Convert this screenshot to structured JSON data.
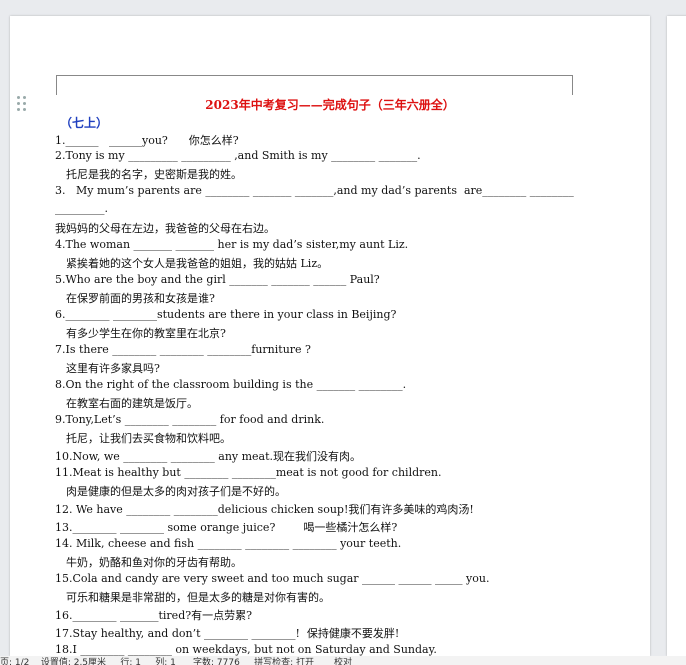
{
  "document": {
    "title": "2023年中考复习——完成句子（三年六册全）",
    "section": "（七上）",
    "lines": [
      "1.______   ______you?      你怎么样?",
      "2.Tony is my _________ _________ ,and Smith is my ________ _______.",
      "托尼是我的名字，史密斯是我的姓。",
      "3.   My mum’s parents are ________ _______ _______,and my dad’s parents  are________ ________",
      "_________.",
      "我妈妈的父母在左边，我爸爸的父母在右边。",
      "4.The woman _______ _______ her is my dad’s sister,my aunt Liz.",
      "紧挨着她的这个女人是我爸爸的姐姐，我的姑姑 Liz。",
      "5.Who are the boy and the girl _______ _______ ______ Paul?",
      "在保罗前面的男孩和女孩是谁?",
      "6.________ ________students are there in your class in Beijing?",
      "有多少学生在你的教室里在北京?",
      "7.Is there ________ ________ ________furniture ?",
      "这里有许多家具吗?",
      "8.On the right of the classroom building is the _______ ________.",
      "在教室右面的建筑是饭厅。",
      "9.Tony,Let’s ________ ________ for food and drink.",
      "托尼，让我们去买食物和饮料吧。",
      "10.Now, we ________ ________ any meat.现在我们没有肉。",
      "11.Meat is healthy but ________ ________meat is not good for children.",
      "肉是健康的但是太多的肉对孩子们是不好的。",
      "12. We have ________ ________delicious chicken soup!我们有许多美味的鸡肉汤!",
      "13.________ ________ some orange juice?        喝一些橘汁怎么样?",
      "14. Milk, cheese and fish ________ ________ ________ your teeth.",
      "牛奶，奶酪和鱼对你的牙齿有帮助。",
      "15.Cola and candy are very sweet and too much sugar ______ ______ _____ you.",
      "可乐和糖果是非常甜的，但是太多的糖是对你有害的。",
      "16.________ _______tired?有一点劳累?",
      "17.Stay healthy, and don’t ________ ________!  保持健康不要发胖!",
      "18.I ________ ________ on weekdays, but not on Saturday and Sunday."
    ]
  },
  "status_bar": {
    "text": "页: 1/2    设置值: 2.5厘米     行: 1     列: 1      字数: 7776     拼写检查: 打开       校对"
  }
}
